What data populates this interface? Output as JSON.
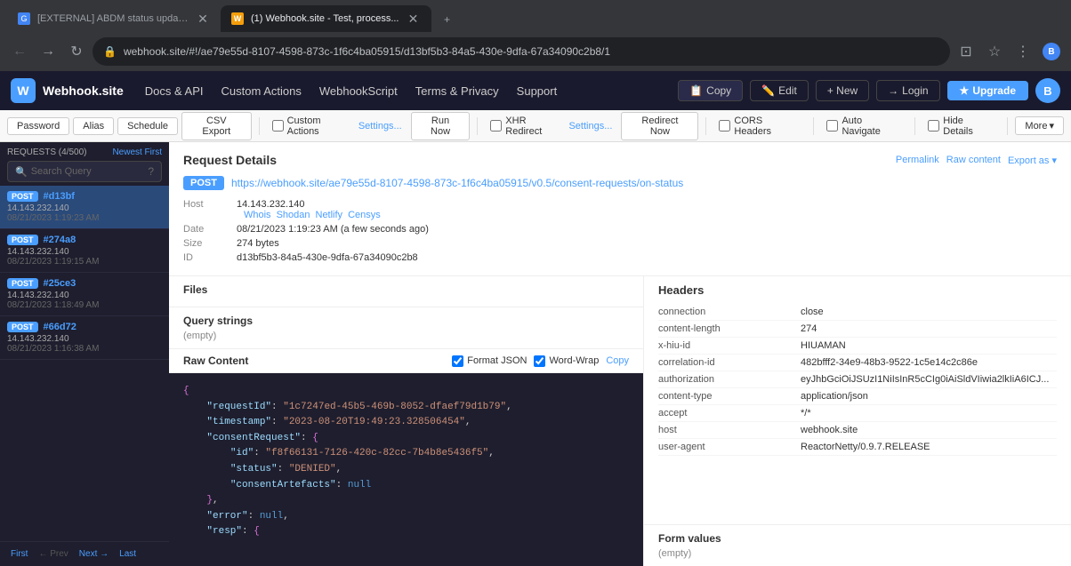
{
  "browser": {
    "tabs": [
      {
        "id": "tab1",
        "title": "[EXTERNAL] ABDM status update...",
        "favicon_color": "#4285f4",
        "active": false
      },
      {
        "id": "tab2",
        "title": "(1) Webhook.site - Test, process...",
        "favicon_color": "#f59e0b",
        "active": true
      }
    ],
    "address": "webhook.site/#!/ae79e55d-8107-4598-873c-1f6c4ba05915/d13bf5b3-84a5-430e-9dfa-67a34090c2b8/1"
  },
  "topnav": {
    "logo": "W",
    "brand": "Webhook.site",
    "links": [
      {
        "id": "docs",
        "label": "Docs & API"
      },
      {
        "id": "custom",
        "label": "Custom Actions"
      },
      {
        "id": "webhook",
        "label": "WebhookScript"
      },
      {
        "id": "terms",
        "label": "Terms & Privacy"
      },
      {
        "id": "support",
        "label": "Support"
      }
    ],
    "copy_btn": "Copy",
    "edit_btn": "Edit",
    "new_btn": "+ New",
    "login_btn": "Login",
    "upgrade_btn": "Upgrade",
    "avatar": "B"
  },
  "toolbar": {
    "buttons": [
      {
        "id": "password",
        "label": "Password"
      },
      {
        "id": "alias",
        "label": "Alias"
      },
      {
        "id": "schedule",
        "label": "Schedule"
      },
      {
        "id": "csv",
        "label": "CSV Export"
      }
    ],
    "checkboxes": [
      {
        "id": "custom-actions",
        "label": "Custom Actions",
        "suffix": "Settings...",
        "checked": false
      },
      {
        "id": "run-now",
        "label": "Run Now",
        "checked": false
      },
      {
        "id": "xhr-redirect",
        "label": "XHR Redirect",
        "suffix": "Settings...",
        "checked": false
      },
      {
        "id": "redirect-now",
        "label": "Redirect Now",
        "checked": false
      },
      {
        "id": "cors",
        "label": "CORS Headers",
        "checked": false
      },
      {
        "id": "auto-nav",
        "label": "Auto Navigate",
        "checked": false
      },
      {
        "id": "hide-details",
        "label": "Hide Details",
        "checked": false
      }
    ],
    "more_btn": "More"
  },
  "sidebar": {
    "requests_label": "REQUESTS (4/500)",
    "order_label": "Newest First",
    "search_placeholder": "Search Query",
    "items": [
      {
        "id": "d13bf",
        "method": "POST",
        "hash": "#d13bf",
        "ip": "14.143.232.140",
        "time": "08/21/2023 1:19:23 AM",
        "active": true
      },
      {
        "id": "274a8",
        "method": "POST",
        "hash": "#274a8",
        "ip": "14.143.232.140",
        "time": "08/21/2023 1:19:15 AM",
        "active": false
      },
      {
        "id": "25ce3",
        "method": "POST",
        "hash": "#25ce3",
        "ip": "14.143.232.140",
        "time": "08/21/2023 1:18:49 AM",
        "active": false
      },
      {
        "id": "66d72",
        "method": "POST",
        "hash": "#66d72",
        "ip": "14.143.232.140",
        "time": "08/21/2023 1:16:38 AM",
        "active": false
      }
    ],
    "pagination": {
      "first": "First",
      "prev": "← Prev",
      "next": "Next →",
      "last": "Last"
    }
  },
  "request_details": {
    "title": "Request Details",
    "actions": [
      "Permalink",
      "Raw content",
      "Export as ▾"
    ],
    "method": "POST",
    "url": "https://webhook.site/ae79e55d-8107-4598-873c-1f6c4ba05915/v0.5/consent-requests/on-status",
    "fields": [
      {
        "label": "Host",
        "value": "14.143.232.140",
        "lookups": [
          "Whois",
          "Shodan",
          "Netlify",
          "Censys"
        ]
      },
      {
        "label": "Date",
        "value": "08/21/2023 1:19:23 AM (a few seconds ago)"
      },
      {
        "label": "Size",
        "value": "274 bytes"
      },
      {
        "label": "ID",
        "value": "d13bf5b3-84a5-430e-9dfa-67a34090c2b8"
      }
    ],
    "files_title": "Files",
    "query_strings_title": "Query strings",
    "query_empty": "(empty)"
  },
  "headers": {
    "title": "Headers",
    "items": [
      {
        "name": "connection",
        "value": "close"
      },
      {
        "name": "content-length",
        "value": "274"
      },
      {
        "name": "x-hiu-id",
        "value": "HIUAMAN"
      },
      {
        "name": "correlation-id",
        "value": "482bfff2-34e9-48b3-9522-1c5e14c2c86e"
      },
      {
        "name": "authorization",
        "value": "eyJhbGciOiJSUzI1NiIsInR5cCIg0iAiSldVIiwia2lkIiA6ICJ..."
      },
      {
        "name": "content-type",
        "value": "application/json"
      },
      {
        "name": "accept",
        "value": "*/*"
      },
      {
        "name": "host",
        "value": "webhook.site"
      },
      {
        "name": "user-agent",
        "value": "ReactorNetty/0.9.7.RELEASE"
      }
    ]
  },
  "form_values": {
    "title": "Form values",
    "empty": "(empty)"
  },
  "raw_content": {
    "title": "Raw Content",
    "format_json_label": "Format JSON",
    "format_json_checked": true,
    "word_wrap_label": "Word-Wrap",
    "word_wrap_checked": true,
    "copy_btn": "Copy",
    "content_lines": [
      "{",
      "    \"requestId\": \"1c7247ed-45b5-469b-8052-dfaef79d1b79\",",
      "    \"timestamp\": \"2023-08-20T19:49:23.328506454\",",
      "    \"consentRequest\": {",
      "        \"id\": \"f8f66131-7126-420c-82cc-7b4b8e5436f5\",",
      "        \"status\": \"DENIED\",",
      "        \"consentArtefacts\": null",
      "    },",
      "    \"error\": null,",
      "    \"resp\": {"
    ]
  }
}
